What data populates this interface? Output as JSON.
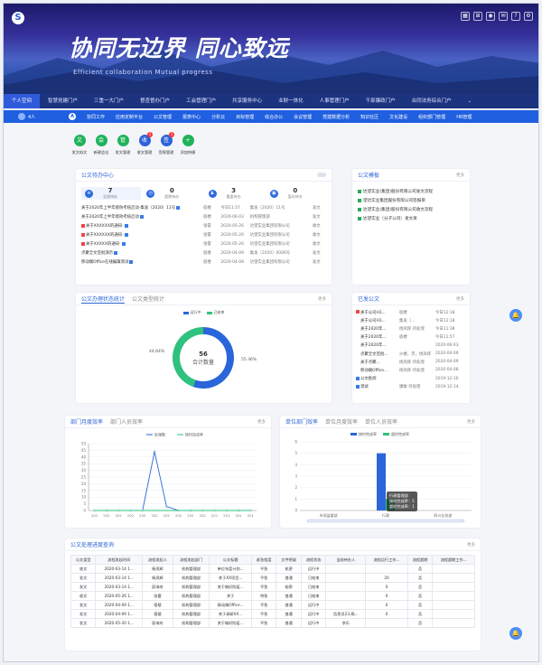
{
  "header": {
    "slogan": "协同无边界 同心致远",
    "slogan_en": "Efficient collaboration Mutual progress",
    "logo_glyph": "S",
    "icons": [
      "grid-icon",
      "apps-icon",
      "user-icon",
      "chat-icon",
      "help-icon",
      "settings-icon"
    ]
  },
  "nav": {
    "items": [
      "个人空间",
      "智慧党建门户",
      "三重一大门户",
      "督查督办门户",
      "工会管理门户",
      "共享服务中心",
      "业财一体化",
      "人事管理门户",
      "干部廉政门户",
      "合同法务综合门户"
    ],
    "more": "⌄"
  },
  "subnav": {
    "user": "4人",
    "home": "A",
    "items": [
      "协同工作",
      "应用定制平台",
      "公文管理",
      "报表中心",
      "分析云",
      "目标管理",
      "综合办公",
      "会议管理",
      "党建数据分析",
      "知识社区",
      "文化建设",
      "组织部门管理",
      "HR管理"
    ]
  },
  "quick": [
    {
      "label": "发文拟文",
      "color": "#1fb35a",
      "glyph": "文",
      "badge": ""
    },
    {
      "label": "新建会议",
      "color": "#1fb35a",
      "glyph": "会",
      "badge": ""
    },
    {
      "label": "发文管理",
      "color": "#1fb35a",
      "glyph": "管",
      "badge": ""
    },
    {
      "label": "收文管理",
      "color": "#2d62d8",
      "glyph": "收",
      "badge": "1"
    },
    {
      "label": "签报管理",
      "color": "#2d62d8",
      "glyph": "签",
      "badge": "1"
    },
    {
      "label": "添加快捷",
      "color": "#1fb35a",
      "glyph": "+",
      "badge": ""
    }
  ],
  "todo_card": {
    "title": "公文待办中心",
    "stats": [
      {
        "num": "7",
        "label": "全部待办",
        "color": "#2f6be0"
      },
      {
        "num": "0",
        "label": "超期待办",
        "color": "#2f6be0"
      },
      {
        "num": "3",
        "label": "重要待办",
        "color": "#2f6be0"
      },
      {
        "num": "0",
        "label": "暂存待办",
        "color": "#2f6be0"
      }
    ],
    "rows": [
      {
        "title": "关于2020年上半年绩效考核启动-集发〔2020〕11号",
        "person": "宿楼",
        "date": "今日11:57",
        "org": "集发〔2020〕11号",
        "type": "发文",
        "red": false
      },
      {
        "title": "关于2020年上半年绩效考核启动",
        "person": "宿楼",
        "date": "2020-06-03",
        "org": "机构管理部",
        "type": "发文",
        "red": false
      },
      {
        "title": "关于XXXXXX的通知-",
        "person": "张雷",
        "date": "2020-05-26",
        "org": "达望实业集团有限公司",
        "type": "收文",
        "red": true
      },
      {
        "title": "关于XXXXXX的通知-",
        "person": "张雷",
        "date": "2020-05-26",
        "org": "达望实业集团有限公司",
        "type": "收文",
        "red": true
      },
      {
        "title": "关于XXXXX的通知-",
        "person": "张雷",
        "date": "2020-05-26",
        "org": "达望实业集团有限公司",
        "type": "收文",
        "red": true
      },
      {
        "title": "点聚全文签批演示",
        "person": "宿楼",
        "date": "2020-04-09",
        "org": "集发〔2020〕0006号",
        "type": "发文",
        "red": false
      },
      {
        "title": "移动端Office在线编辑测试",
        "person": "宿楼",
        "date": "2020-04-08",
        "org": "达望实业集团有限公司",
        "type": "发文",
        "red": false
      }
    ]
  },
  "template_card": {
    "title": "公文模板",
    "more": "更多",
    "items": [
      "达望实业(集团)股份有限公司发文流程",
      "望达实业集团股份有限公司签报单",
      "达望实业(集团)股份有限公司收文流程",
      "达望实业（分子公司）发文单"
    ]
  },
  "status_card": {
    "tab1": "公文办理状态统计",
    "tab2": "公文类型统计",
    "more": "更多",
    "legend": [
      "运行中",
      "已结束"
    ],
    "colors": [
      "#2a66d9",
      "#2ec27e"
    ],
    "values": [
      55.36,
      44.64
    ],
    "labels": [
      "55.36%",
      "44.64%"
    ],
    "center_num": "56",
    "center_label": "合计数量"
  },
  "read_card": {
    "title": "已发公文",
    "more": "更多",
    "rows": [
      {
        "title": "关于公司H1...",
        "person": "宿楼",
        "date": "今日12:18",
        "red": true,
        "tag": false
      },
      {
        "title": "关于公司H1...",
        "person": "集发〔...",
        "date": "今日12:18",
        "red": false,
        "tag": false
      },
      {
        "title": "关于2020年...",
        "person": "杨凤辉 待处理",
        "date": "今日11:38",
        "red": false,
        "tag": false
      },
      {
        "title": "关于2020年...",
        "person": "宿楼",
        "date": "今日11:57",
        "red": false,
        "tag": false
      },
      {
        "title": "关于2020年...",
        "person": "",
        "date": "2020-06-03",
        "red": false,
        "tag": false
      },
      {
        "title": "点聚全文签批...",
        "person": "沙楼，李，杨凤辉",
        "date": "2020-04-09",
        "red": false,
        "tag": false
      },
      {
        "title": "关于点聚...",
        "person": "杨凤辉 待处理",
        "date": "2020-04-09",
        "red": false,
        "tag": false
      },
      {
        "title": "移动端Office...",
        "person": "杨凤辉 待处理",
        "date": "2020-04-08",
        "red": false,
        "tag": false
      },
      {
        "title": "公文批阅",
        "person": "",
        "date": "2019-12-16",
        "red": false,
        "tag": true
      },
      {
        "title": "测试",
        "person": "康敏 待处理",
        "date": "2019-12-14",
        "red": false,
        "tag": true
      }
    ]
  },
  "dept_card": {
    "tab1": "部门月度效率",
    "tab2": "部门人员效率",
    "more": "更多"
  },
  "unit_card": {
    "tab1": "单位部门效率",
    "tab2": "单位月度效率",
    "tab3": "单位人员效率",
    "more": "更多",
    "tooltip": {
      "title": "行政管理部",
      "line1": "按时完成率：5",
      "line2": "超时完成率：1"
    }
  },
  "chart_data": [
    {
      "type": "line",
      "series": [
        {
          "name": "处理数",
          "color": "#2a66d9",
          "values": [
            0,
            0,
            0,
            0,
            0,
            44,
            3,
            0,
            0,
            0,
            0,
            0,
            0,
            0
          ]
        },
        {
          "name": "按时完成率",
          "color": "#2ec27e",
          "values": [
            0,
            0,
            0,
            0,
            0,
            0,
            0,
            0,
            0,
            0,
            0,
            0,
            0,
            0
          ]
        }
      ],
      "x": [
        "202",
        "202",
        "202",
        "202",
        "202",
        "202",
        "202",
        "202",
        "202",
        "202",
        "201",
        "201",
        "201",
        "201"
      ],
      "ylim": [
        0,
        50
      ],
      "yticks": [
        0,
        5,
        10,
        15,
        20,
        25,
        30,
        35,
        40,
        45,
        50
      ],
      "grid": true,
      "legend": "top-center"
    },
    {
      "type": "bar",
      "categories": [
        "市场监督部",
        "行政",
        "四川业务部"
      ],
      "series": [
        {
          "name": "按时完成率",
          "color": "#2a66d9",
          "values": [
            0,
            5,
            0
          ]
        },
        {
          "name": "超时完成率",
          "color": "#2ec27e",
          "values": [
            0,
            1,
            0
          ]
        }
      ],
      "ylim": [
        0,
        6
      ],
      "yticks": [
        0,
        1,
        2,
        3,
        4,
        5,
        6
      ],
      "grid": true,
      "legend": "top-center"
    }
  ],
  "query_card": {
    "title": "公文处理进度查询",
    "more": "更多",
    "columns": [
      "公文类型",
      "流程发起时间",
      "流程发起人",
      "流程发起部门",
      "公文标题",
      "紧急程度",
      "文件密级",
      "流程状态",
      "当前待办人",
      "流程运行工作...",
      "流程超期",
      "流程超期工作..."
    ],
    "rows": [
      [
        "收文",
        "2020-03-14 1...",
        "杨凤辉",
        "机构管理部",
        "单位年度计划...",
        "平急",
        "机密",
        "运行中",
        "",
        "",
        "否",
        ""
      ],
      [
        "发文",
        "2020-03-14 1...",
        "杨凤辉",
        "机构管理部",
        "关于XX项目...",
        "平急",
        "普通",
        "已结束",
        "",
        "20",
        "否",
        ""
      ],
      [
        "发文",
        "2020-03-14 1...",
        "邱海舟",
        "机构管理部",
        "关于做好防疫...",
        "平急",
        "秘密",
        "已结束",
        "",
        "0",
        "否",
        ""
      ],
      [
        "收文",
        "2020-05-26 1...",
        "张雷",
        "机构管理部",
        "关于",
        "特急",
        "普通",
        "已结束",
        "",
        "0",
        "否",
        ""
      ],
      [
        "发文",
        "2020-04-09 1...",
        "宿楼",
        "机构管理部",
        "移动端Office...",
        "平急",
        "普通",
        "运行中",
        "",
        "0",
        "否",
        ""
      ],
      [
        "发文",
        "2020-04-09 1...",
        "宿楼",
        "机构管理部",
        "关于调研XX...",
        "平急",
        "普通",
        "运行中",
        "信息员23,杨...",
        "0",
        "否",
        ""
      ],
      [
        "发文",
        "2020-05-20 1...",
        "邱海舟",
        "机构管理部",
        "关于做好防疫...",
        "平急",
        "普通",
        "运行中",
        "李乐",
        "",
        "否",
        ""
      ]
    ]
  },
  "fab": "🔔"
}
